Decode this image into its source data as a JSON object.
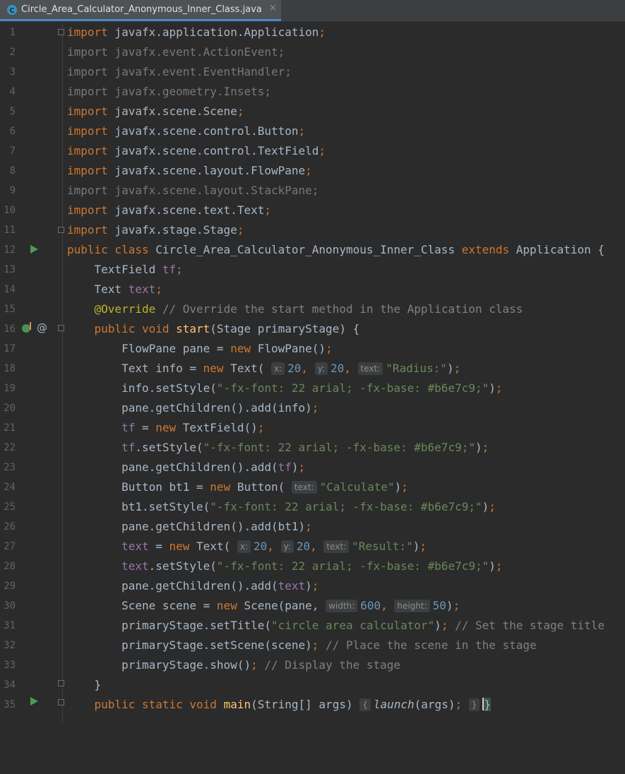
{
  "tab": {
    "title": "Circle_Area_Calculator_Anonymous_Inner_Class.java",
    "close_glyph": "×",
    "icon": "java-class-icon"
  },
  "editor": {
    "line_numbers": [
      "1",
      "2",
      "3",
      "4",
      "5",
      "6",
      "7",
      "8",
      "9",
      "10",
      "11",
      "12",
      "13",
      "14",
      "15",
      "16",
      "17",
      "18",
      "19",
      "20",
      "21",
      "22",
      "23",
      "24",
      "25",
      "26",
      "27",
      "28",
      "29",
      "30",
      "31",
      "32",
      "33",
      "34",
      "35"
    ]
  },
  "code": {
    "l1": {
      "kw": "import",
      "rest": " javafx.application.Application",
      "semi": ";"
    },
    "l2": "import javafx.event.ActionEvent;",
    "l3": "import javafx.event.EventHandler;",
    "l4": "import javafx.geometry.Insets;",
    "l5": {
      "kw": "import",
      "rest": " javafx.scene.Scene",
      "semi": ";"
    },
    "l6": {
      "kw": "import",
      "rest": " javafx.scene.control.Button",
      "semi": ";"
    },
    "l7": {
      "kw": "import",
      "rest": " javafx.scene.control.TextField",
      "semi": ";"
    },
    "l8": {
      "kw": "import",
      "rest": " javafx.scene.layout.FlowPane",
      "semi": ";"
    },
    "l9": "import javafx.scene.layout.StackPane;",
    "l10": {
      "kw": "import",
      "rest": " javafx.scene.text.Text",
      "semi": ";"
    },
    "l11": {
      "kw": "import",
      "rest": " javafx.stage.Stage",
      "semi": ";"
    },
    "l12": {
      "kw1": "public class",
      "name": " Circle_Area_Calculator_Anonymous_Inner_Class ",
      "kw2": "extends",
      "rest": " Application {"
    },
    "l13": {
      "type": "TextField ",
      "field": "tf",
      "semi": ";"
    },
    "l14": {
      "type": "Text ",
      "field": "text",
      "semi": ";"
    },
    "l15": {
      "ann": "@Override",
      "comment": " // Override the start method in the Application class"
    },
    "l16": {
      "kw": "public void ",
      "fn": "start",
      "rest": "(Stage primaryStage) {"
    },
    "l17": {
      "pre": "FlowPane pane = ",
      "kw": "new",
      "post": " FlowPane()",
      "semi": ";"
    },
    "l18": {
      "pre": "Text info = ",
      "kw": "new",
      "post": " Text(",
      "h1": "x:",
      "n1": "20",
      "h2": "y:",
      "n2": "20",
      "h3": "text:",
      "str": "\"Radius:\"",
      "end": ")",
      "semi": ";"
    },
    "l19": {
      "pre": "info.setStyle(",
      "str": "\"-fx-font: 22 arial; -fx-base: #b6e7c9;\"",
      "end": ")",
      "semi": ";"
    },
    "l20": {
      "pre": "pane.getChildren().add(info)",
      "semi": ";"
    },
    "l21": {
      "field": "tf",
      "mid": " = ",
      "kw": "new",
      "post": " TextField()",
      "semi": ";"
    },
    "l22": {
      "field": "tf",
      "pre": ".setStyle(",
      "str": "\"-fx-font: 22 arial; -fx-base: #b6e7c9;\"",
      "end": ")",
      "semi": ";"
    },
    "l23": {
      "pre": "pane.getChildren().add(",
      "field": "tf",
      "end": ")",
      "semi": ";"
    },
    "l24": {
      "pre": "Button bt1 = ",
      "kw": "new",
      "post": " Button(",
      "h1": "text:",
      "str": "\"Calculate\"",
      "end": ")",
      "semi": ";"
    },
    "l25": {
      "pre": "bt1.setStyle(",
      "str": "\"-fx-font: 22 arial; -fx-base: #b6e7c9;\"",
      "end": ")",
      "semi": ";"
    },
    "l26": {
      "pre": "pane.getChildren().add(bt1)",
      "semi": ";"
    },
    "l27": {
      "field": "text",
      "mid": " = ",
      "kw": "new",
      "post": " Text(",
      "h1": "x:",
      "n1": "20",
      "h2": "y:",
      "n2": "20",
      "h3": "text:",
      "str": "\"Result:\"",
      "end": ")",
      "semi": ";"
    },
    "l28": {
      "field": "text",
      "pre": ".setStyle(",
      "str": "\"-fx-font: 22 arial; -fx-base: #b6e7c9;\"",
      "end": ")",
      "semi": ";"
    },
    "l29": {
      "pre": "pane.getChildren().add(",
      "field": "text",
      "end": ")",
      "semi": ";"
    },
    "l30": {
      "pre": "Scene scene = ",
      "kw": "new",
      "post": " Scene(pane,",
      "h1": "width:",
      "n1": "600",
      "h2": "height:",
      "n2": "50",
      "end": ")",
      "semi": ";"
    },
    "l31": {
      "pre": "primaryStage.setTitle(",
      "str": "\"circle area calculator\"",
      "end": ")",
      "semi": ";",
      "comment": " // Set the stage title"
    },
    "l32": {
      "pre": "primaryStage.setScene(scene)",
      "semi": ";",
      "comment": " // Place the scene in the stage"
    },
    "l33": {
      "pre": "primaryStage.show()",
      "semi": ";",
      "comment": " // Display the stage"
    },
    "l34": "}",
    "l35": {
      "kw": "public static void ",
      "fn": "main",
      "rest": "(String[] args) ",
      "ob": "{",
      "call": "launch",
      "args": "(args)",
      "semi": ";",
      "cb": "}",
      "last": "}"
    }
  },
  "colors": {
    "background": "#2b2b2b",
    "keyword": "#cc7832",
    "string": "#6a8759",
    "number": "#6897bb",
    "field": "#9876aa",
    "annotation": "#bbb529",
    "function": "#ffc66d"
  }
}
